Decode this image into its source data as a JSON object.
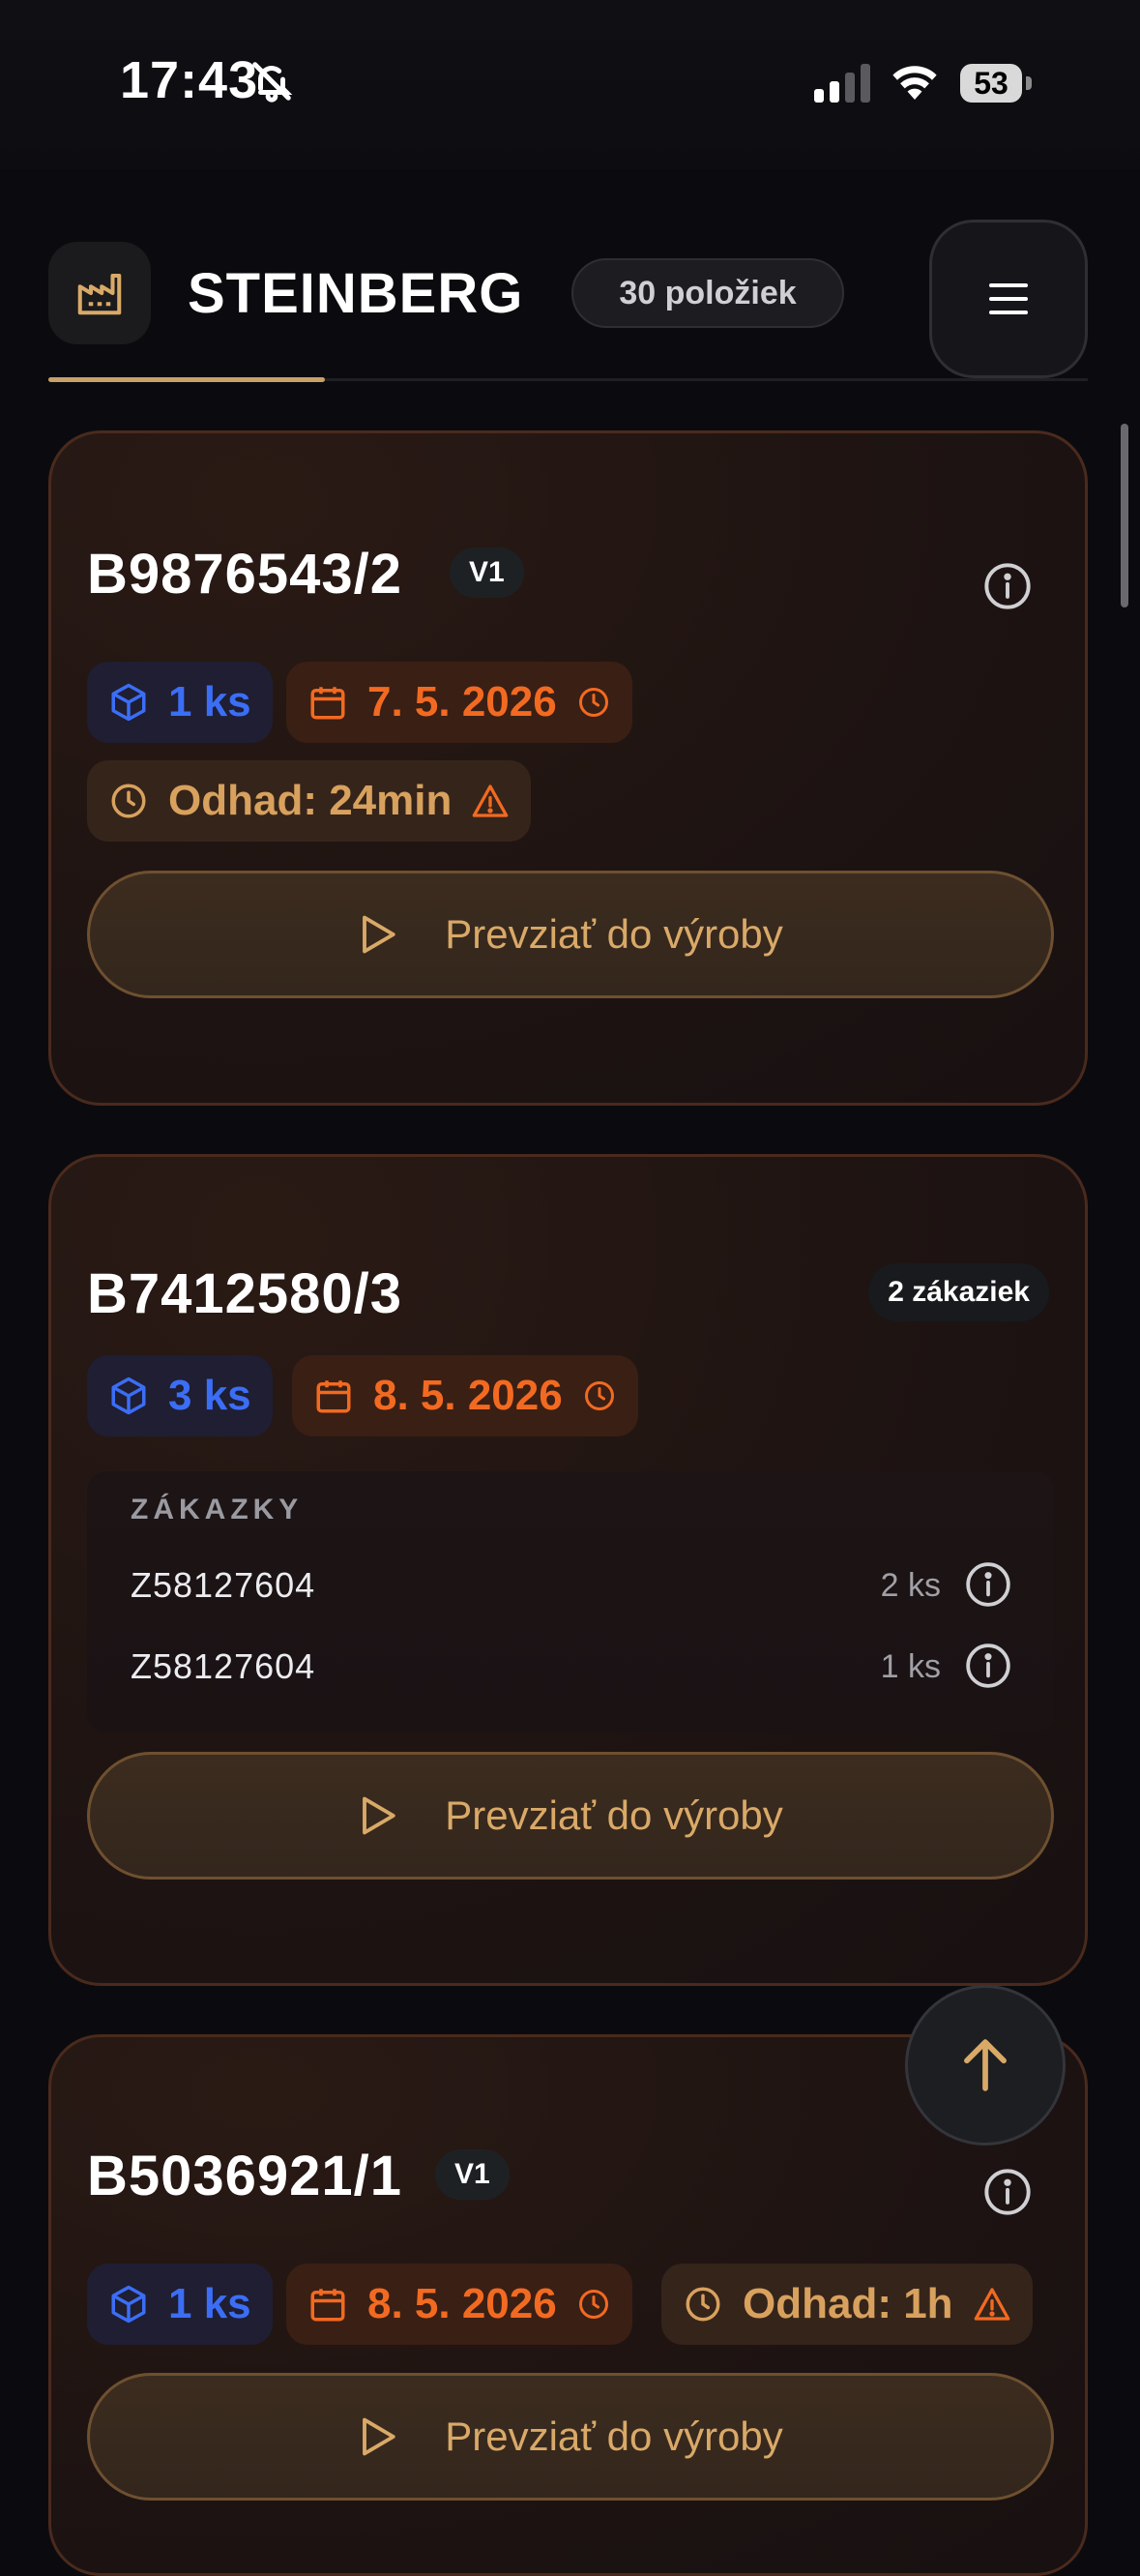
{
  "status_bar": {
    "time": "17:43",
    "battery": "53"
  },
  "header": {
    "brand": "STEINBERG",
    "item_count": "30 položiek"
  },
  "cards": [
    {
      "code": "B9876543/2",
      "version": "V1",
      "quantity": "1 ks",
      "date": "7. 5. 2026",
      "estimate": "Odhad: 24min",
      "action_label": "Prevziať do výroby"
    },
    {
      "code": "B7412580/3",
      "orders_count": "2 zákaziek",
      "quantity": "3 ks",
      "date": "8. 5. 2026",
      "orders_heading": "ZÁKAZKY",
      "orders": [
        {
          "id": "Z58127604",
          "qty": "2 ks"
        },
        {
          "id": "Z58127604",
          "qty": "1 ks"
        }
      ],
      "action_label": "Prevziať do výroby"
    },
    {
      "code": "B5036921/1",
      "version": "V1",
      "quantity": "1 ks",
      "date": "8. 5. 2026",
      "estimate": "Odhad: 1h",
      "action_label": "Prevziať do výroby"
    }
  ],
  "colors": {
    "accent": "#c8a06a",
    "qty_blue": "#3b6ef5",
    "date_orange": "#f26a21",
    "estimate_gold": "#d8a15e"
  }
}
